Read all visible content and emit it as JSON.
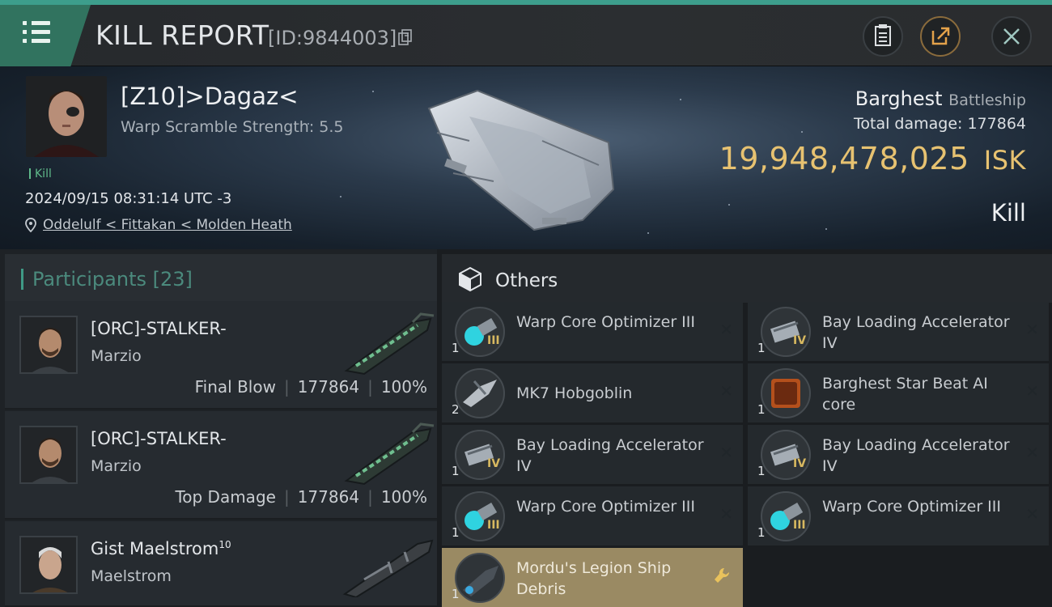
{
  "header": {
    "title": "KILL REPORT",
    "report_id": "[ID:9844003]"
  },
  "victim": {
    "name": "[Z10]>Dagaz<",
    "stat": "Warp Scramble Strength: 5.5",
    "tag": "Kill",
    "datetime": "2024/09/15 08:31:14 UTC -3",
    "location": "Oddelulf < Fittakan < Molden Heath"
  },
  "ship": {
    "name": "Barghest",
    "class": "Battleship",
    "total_damage_label": "Total damage:",
    "total_damage": "177864",
    "isk_value": "19,948,478,025",
    "isk_unit": "ISK",
    "result": "Kill"
  },
  "participants": {
    "title": "Participants",
    "count": "[23]",
    "rows": [
      {
        "name": "[ORC]-STALKER-",
        "ship": "Marzio",
        "label": "Final Blow",
        "damage": "177864",
        "pct": "100%"
      },
      {
        "name": "[ORC]-STALKER-",
        "ship": "Marzio",
        "label": "Top Damage",
        "damage": "177864",
        "pct": "100%"
      },
      {
        "name": "Gist Maelstrom",
        "sup": "10",
        "ship": "Maelstrom"
      }
    ]
  },
  "others": {
    "title": "Others",
    "items": [
      {
        "name": "Warp Core Optimizer III",
        "qty": "1",
        "tier": "III",
        "icon": "warp-core-optimizer-icon"
      },
      {
        "name": "Bay Loading Accelerator IV",
        "qty": "1",
        "tier": "IV",
        "icon": "bay-loading-accelerator-icon"
      },
      {
        "name": "MK7 Hobgoblin",
        "qty": "2",
        "tier": "",
        "icon": "hobgoblin-drone-icon"
      },
      {
        "name": "Barghest Star Beat AI core",
        "qty": "1",
        "tier": "",
        "icon": "ai-core-icon"
      },
      {
        "name": "Bay Loading Accelerator IV",
        "qty": "1",
        "tier": "IV",
        "icon": "bay-loading-accelerator-icon"
      },
      {
        "name": "Bay Loading Accelerator IV",
        "qty": "1",
        "tier": "IV",
        "icon": "bay-loading-accelerator-icon"
      },
      {
        "name": "Warp Core Optimizer III",
        "qty": "1",
        "tier": "III",
        "icon": "warp-core-optimizer-icon"
      },
      {
        "name": "Warp Core Optimizer III",
        "qty": "1",
        "tier": "III",
        "icon": "warp-core-optimizer-icon"
      },
      {
        "name": "Mordu's Legion Ship Debris",
        "qty": "1",
        "tier": "",
        "icon": "ship-debris-icon"
      }
    ]
  },
  "colors": {
    "accent": "#3d9e8c",
    "isk": "#e7c271",
    "highlight": "#9a8a63"
  }
}
